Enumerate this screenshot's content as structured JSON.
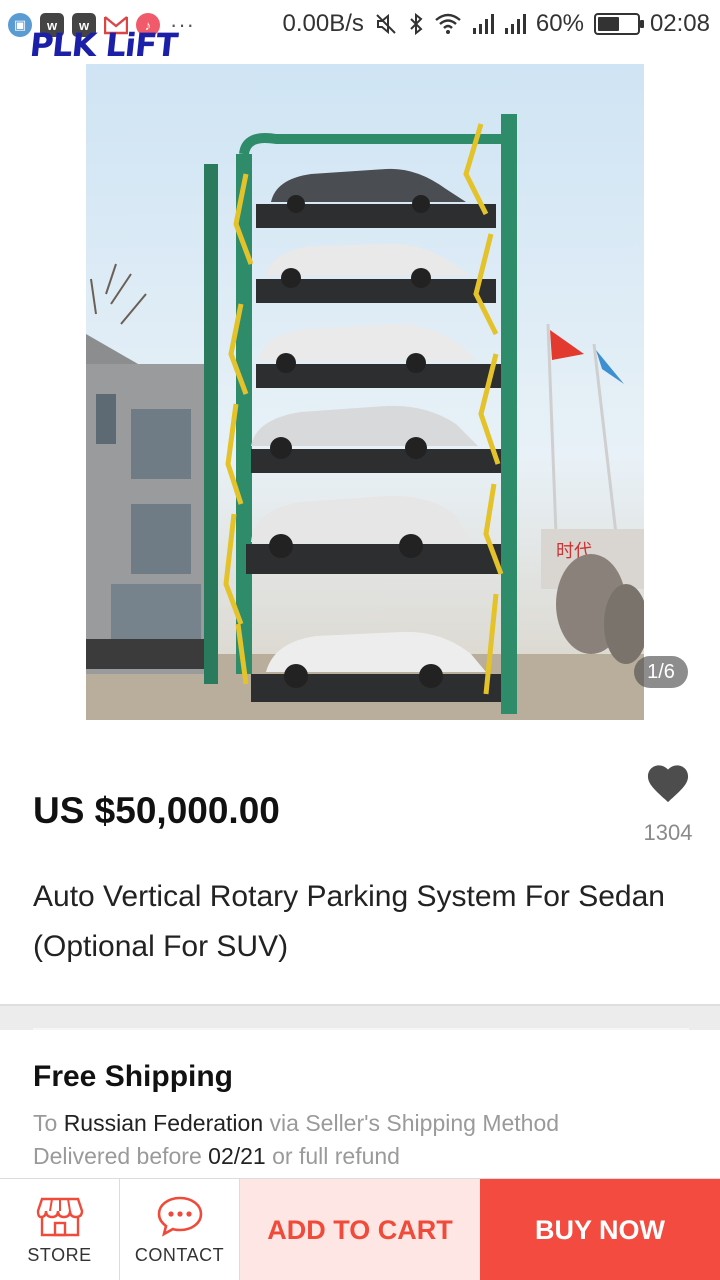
{
  "status_bar": {
    "net_speed": "0.00B/s",
    "battery_percent": "60%",
    "battery_level": 0.6,
    "time": "02:08",
    "more": "···",
    "icons": [
      "screenshot-icon",
      "app-icon",
      "app-icon",
      "gmail-icon",
      "music-icon",
      "mute-icon",
      "bluetooth-icon",
      "wifi-icon",
      "signal-icon",
      "signal-icon",
      "battery-icon"
    ]
  },
  "brand": {
    "logo_text": "PLK LiFT"
  },
  "gallery": {
    "counter": "1/6"
  },
  "product": {
    "price": "US $50,000.00",
    "title": "Auto Vertical Rotary Parking System For Sedan (Optional For SUV)",
    "wishlist_count": "1304"
  },
  "shipping": {
    "title": "Free Shipping",
    "to_prefix": "To",
    "country": "Russian Federation",
    "method": "via Seller's Shipping Method",
    "delivered_prefix": "Delivered before",
    "date": "02/21",
    "refund_text": "or full refund"
  },
  "bottom_bar": {
    "store_label": "STORE",
    "contact_label": "CONTACT",
    "add_to_cart": "ADD TO CART",
    "buy_now": "BUY NOW"
  },
  "colors": {
    "accent": "#f34b3f",
    "accent_light": "#fde6e4",
    "logo": "#1c1fa8"
  }
}
